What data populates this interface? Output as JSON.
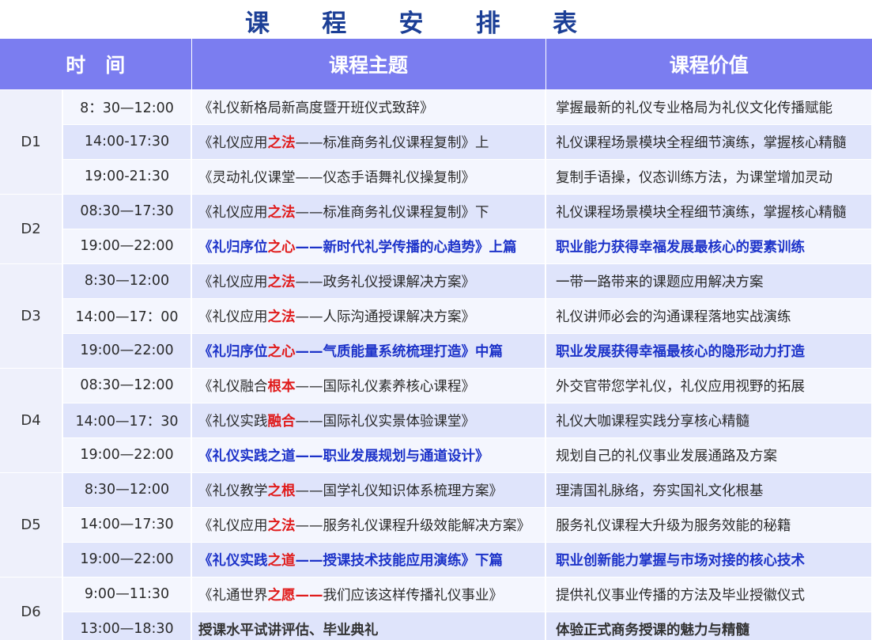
{
  "title_chars": [
    "课",
    "程",
    "安",
    "排",
    "表"
  ],
  "headers": {
    "time": "时　间",
    "topic": "课程主题",
    "value": "课程价值"
  },
  "days": [
    {
      "label": "D1",
      "rows": [
        {
          "time": "8：30—12:00",
          "style": "plain",
          "topic_pre": "《礼仪新格局新高度暨开班仪式致辞》",
          "topic_hl": "",
          "topic_post": "",
          "value": "掌握最新的礼仪专业格局为礼仪文化传播赋能"
        },
        {
          "time": "14:00-17:30",
          "style": "plain",
          "topic_pre": "《礼仪应用",
          "topic_hl": "之法",
          "topic_post": "——标准商务礼仪课程复制》上",
          "value": "礼仪课程场景模块全程细节演练，掌握核心精髓"
        },
        {
          "time": "19:00-21:30",
          "style": "plain",
          "topic_pre": "《灵动礼仪课堂——仪态手语舞礼仪操复制》",
          "topic_hl": "",
          "topic_post": "",
          "value": "复制手语操，仪态训练方法，为课堂增加灵动"
        }
      ]
    },
    {
      "label": "D2",
      "rows": [
        {
          "time": "08:30—17:30",
          "style": "plain",
          "topic_pre": "《礼仪应用",
          "topic_hl": "之法",
          "topic_post": "——标准商务礼仪课程复制》下",
          "value": "礼仪课程场景模块全程细节演练，掌握核心精髓"
        },
        {
          "time": "19:00—22:00",
          "style": "blue",
          "topic_pre": "《礼归序位",
          "topic_hl": "之心",
          "topic_post": "——新时代礼学传播的心趋势》上篇",
          "value": "职业能力获得幸福发展最核心的要素训练"
        }
      ]
    },
    {
      "label": "D3",
      "rows": [
        {
          "time": "8:30—12:00",
          "style": "plain",
          "topic_pre": "《礼仪应用",
          "topic_hl": "之法",
          "topic_post": "——政务礼仪授课解决方案》",
          "value": "一带一路带来的课题应用解决方案"
        },
        {
          "time": "14:00—17：00",
          "style": "plain",
          "topic_pre": "《礼仪应用",
          "topic_hl": "之法",
          "topic_post": "——人际沟通授课解决方案》",
          "value": "礼仪讲师必会的沟通课程落地实战演练"
        },
        {
          "time": "19:00—22:00",
          "style": "blue",
          "topic_pre": "《礼归序位",
          "topic_hl": "之心",
          "topic_post": "——气质能量系统梳理打造》中篇",
          "value": "职业发展获得幸福最核心的隐形动力打造"
        }
      ]
    },
    {
      "label": "D4",
      "rows": [
        {
          "time": "08:30—12:00",
          "style": "plain",
          "topic_pre": "《礼仪融合",
          "topic_hl": "根本",
          "topic_post": "——国际礼仪素养核心课程》",
          "value": "外交官带您学礼仪，礼仪应用视野的拓展"
        },
        {
          "time": "14:00—17：30",
          "style": "plain",
          "topic_pre": "《礼仪实践",
          "topic_hl": "融合",
          "topic_post": "——国际礼仪实景体验课堂》",
          "value": "礼仪大咖课程实践分享核心精髓"
        },
        {
          "time": "19:00—22:00",
          "style": "blueonly",
          "topic_pre": "《礼仪实践之道——职业发展规划与通道设计》",
          "topic_hl": "",
          "topic_post": "",
          "value": "规划自己的礼仪事业发展通路及方案"
        }
      ]
    },
    {
      "label": "D5",
      "rows": [
        {
          "time": "8:30—12:00",
          "style": "plain",
          "topic_pre": "《礼仪教学",
          "topic_hl": "之根",
          "topic_post": "——国学礼仪知识体系梳理方案》",
          "value": "理清国礼脉络，夯实国礼文化根基"
        },
        {
          "time": "14:00—17:30",
          "style": "plain",
          "topic_pre": "《礼仪应用",
          "topic_hl": "之法",
          "topic_post": "——服务礼仪课程升级效能解决方案》",
          "value": "服务礼仪课程大升级为服务效能的秘籍"
        },
        {
          "time": "19:00—22:00",
          "style": "blue",
          "topic_pre": "《礼仪实践",
          "topic_hl": "之道",
          "topic_post": "——授课技术技能应用演练》下篇",
          "value": "职业创新能力掌握与市场对接的核心技术"
        }
      ]
    },
    {
      "label": "D6",
      "rows": [
        {
          "time": "9:00—11:30",
          "style": "plain",
          "topic_pre": "《礼通世界",
          "topic_hl": "之愿——",
          "topic_post": "我们应该这样传播礼仪事业》",
          "value": "提供礼仪事业传播的方法及毕业授徽仪式"
        },
        {
          "time": "13:00—18:30",
          "style": "bolddark",
          "topic_pre": "授课水平试讲评估、毕业典礼",
          "topic_hl": "",
          "topic_post": "",
          "value": "体验正式商务授课的魅力与精髓"
        }
      ]
    }
  ]
}
